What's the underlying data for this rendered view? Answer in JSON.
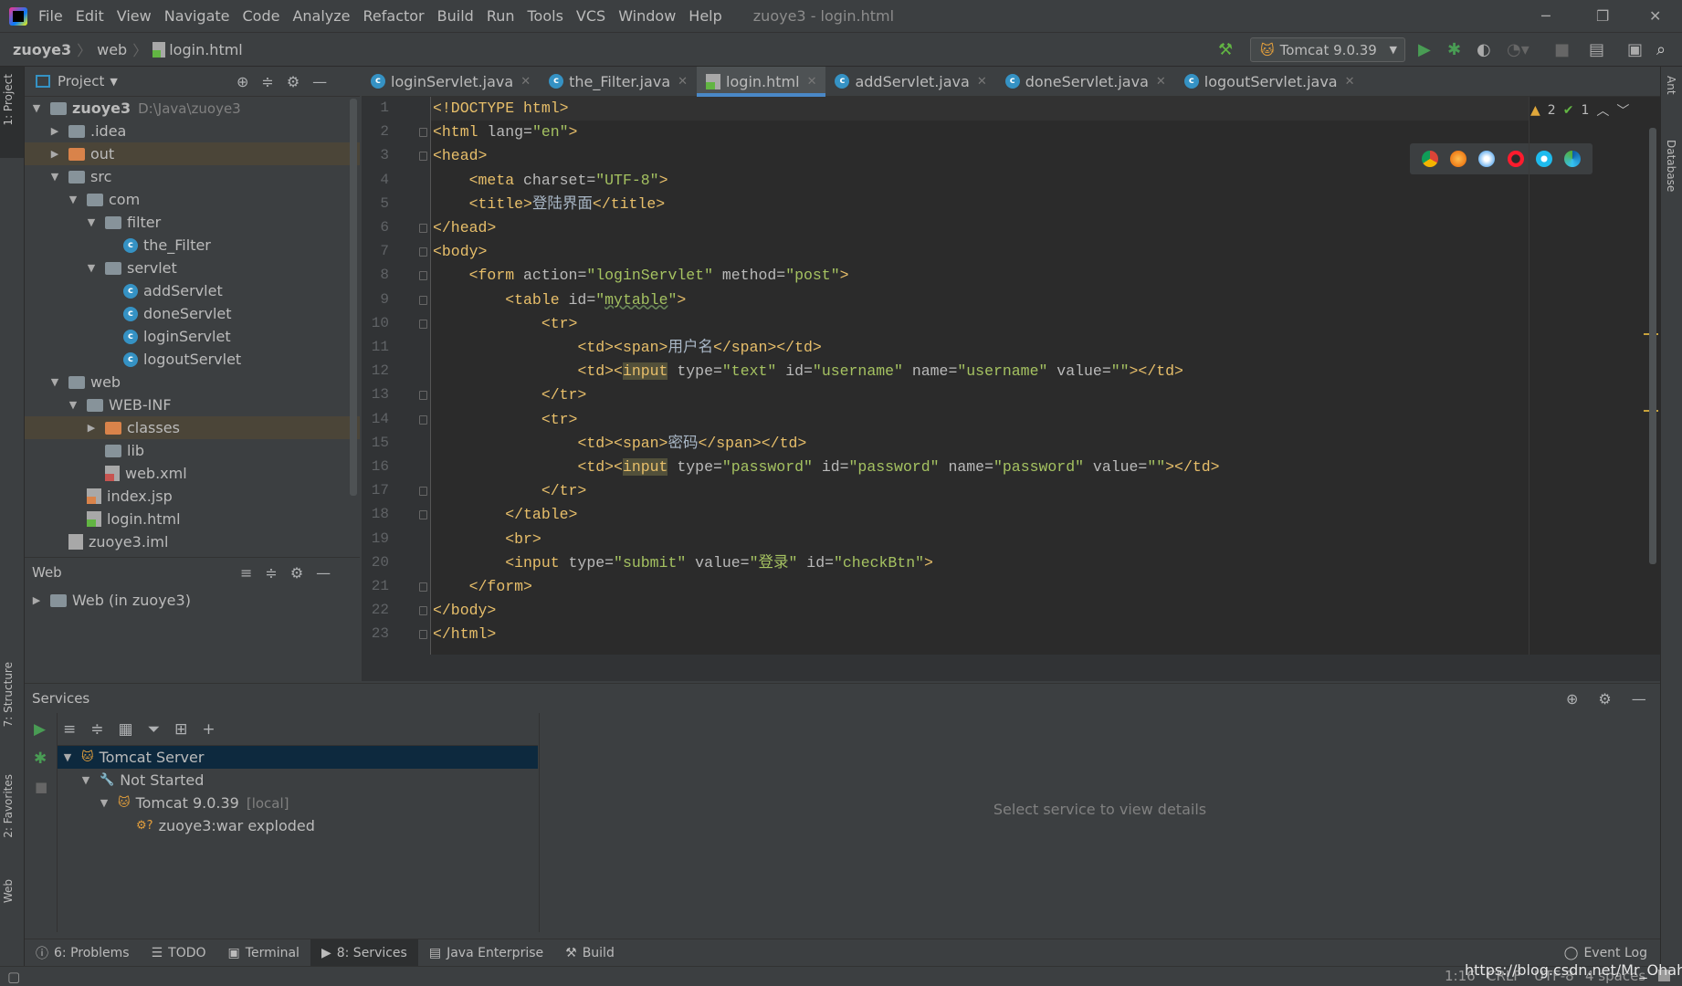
{
  "window": {
    "title": "zuoye3 - login.html",
    "menu": [
      "File",
      "Edit",
      "View",
      "Navigate",
      "Code",
      "Analyze",
      "Refactor",
      "Build",
      "Run",
      "Tools",
      "VCS",
      "Window",
      "Help"
    ]
  },
  "breadcrumb": [
    "zuoye3",
    "web",
    "login.html"
  ],
  "run_config": "Tomcat 9.0.39",
  "left_strip": [
    "1: Project",
    "7: Structure",
    "2: Favorites",
    "Web"
  ],
  "right_strip": [
    "Ant",
    "Database"
  ],
  "project": {
    "title": "Project",
    "tree": [
      {
        "label": "zuoye3",
        "extra": "D:\\Java\\zuoye3",
        "depth": 0,
        "arrow": "down",
        "icon": "module",
        "bold": true
      },
      {
        "label": ".idea",
        "depth": 1,
        "arrow": "right",
        "icon": "folder"
      },
      {
        "label": "out",
        "depth": 1,
        "arrow": "right",
        "icon": "folder-orange",
        "selected": true
      },
      {
        "label": "src",
        "depth": 1,
        "arrow": "down",
        "icon": "folder-blue"
      },
      {
        "label": "com",
        "depth": 2,
        "arrow": "down",
        "icon": "package"
      },
      {
        "label": "filter",
        "depth": 3,
        "arrow": "down",
        "icon": "package"
      },
      {
        "label": "the_Filter",
        "depth": 4,
        "icon": "class"
      },
      {
        "label": "servlet",
        "depth": 3,
        "arrow": "down",
        "icon": "package"
      },
      {
        "label": "addServlet",
        "depth": 4,
        "icon": "class"
      },
      {
        "label": "doneServlet",
        "depth": 4,
        "icon": "class"
      },
      {
        "label": "loginServlet",
        "depth": 4,
        "icon": "class"
      },
      {
        "label": "logoutServlet",
        "depth": 4,
        "icon": "class"
      },
      {
        "label": "web",
        "depth": 1,
        "arrow": "down",
        "icon": "folder-web"
      },
      {
        "label": "WEB-INF",
        "depth": 2,
        "arrow": "down",
        "icon": "folder"
      },
      {
        "label": "classes",
        "depth": 3,
        "arrow": "right",
        "icon": "folder-orange",
        "selected": true
      },
      {
        "label": "lib",
        "depth": 3,
        "icon": "folder"
      },
      {
        "label": "web.xml",
        "depth": 3,
        "icon": "xml"
      },
      {
        "label": "index.jsp",
        "depth": 2,
        "icon": "jsp"
      },
      {
        "label": "login.html",
        "depth": 2,
        "icon": "html"
      },
      {
        "label": "zuoye3.iml",
        "depth": 1,
        "icon": "iml"
      }
    ]
  },
  "web_panel": {
    "title": "Web",
    "items": [
      "Web (in zuoye3)"
    ]
  },
  "tabs": [
    {
      "label": "loginServlet.java",
      "icon": "class"
    },
    {
      "label": "the_Filter.java",
      "icon": "class"
    },
    {
      "label": "login.html",
      "icon": "html",
      "active": true
    },
    {
      "label": "addServlet.java",
      "icon": "class"
    },
    {
      "label": "doneServlet.java",
      "icon": "class"
    },
    {
      "label": "logoutServlet.java",
      "icon": "class"
    }
  ],
  "inspections": {
    "warnings": "2",
    "ok": "1"
  },
  "browsers": [
    "chrome",
    "firefox",
    "safari",
    "opera",
    "ie",
    "edge"
  ],
  "code": [
    [
      [
        "t-tag",
        "<!DOCTYPE html>"
      ]
    ],
    [
      [
        "t-tag",
        "<html "
      ],
      [
        "t-attr",
        "lang="
      ],
      [
        "t-val",
        "\"en\""
      ],
      [
        "t-tag",
        ">"
      ]
    ],
    [
      [
        "t-tag",
        "<head>"
      ]
    ],
    [
      [
        "t-text",
        "    "
      ],
      [
        "t-tag",
        "<meta "
      ],
      [
        "t-attr",
        "charset="
      ],
      [
        "t-val",
        "\"UTF-8\""
      ],
      [
        "t-tag",
        ">"
      ]
    ],
    [
      [
        "t-text",
        "    "
      ],
      [
        "t-tag",
        "<title>"
      ],
      [
        "t-text",
        "登陆界面"
      ],
      [
        "t-tag",
        "</title>"
      ]
    ],
    [
      [
        "t-tag",
        "</head>"
      ]
    ],
    [
      [
        "t-tag",
        "<body>"
      ]
    ],
    [
      [
        "t-text",
        "    "
      ],
      [
        "t-tag",
        "<form "
      ],
      [
        "t-attr",
        "action="
      ],
      [
        "t-val",
        "\"loginServlet\""
      ],
      [
        "t-attr",
        " method="
      ],
      [
        "t-val",
        "\"post\""
      ],
      [
        "t-tag",
        ">"
      ]
    ],
    [
      [
        "t-text",
        "        "
      ],
      [
        "t-tag",
        "<table "
      ],
      [
        "t-attr",
        "id="
      ],
      [
        "t-val",
        "\""
      ],
      [
        "t-und",
        "mytable"
      ],
      [
        "t-val",
        "\""
      ],
      [
        "t-tag",
        ">"
      ]
    ],
    [
      [
        "t-text",
        "            "
      ],
      [
        "t-tag",
        "<tr>"
      ]
    ],
    [
      [
        "t-text",
        "                "
      ],
      [
        "t-tag",
        "<td><span>"
      ],
      [
        "t-text",
        "用户名"
      ],
      [
        "t-tag",
        "</span></td>"
      ]
    ],
    [
      [
        "t-text",
        "                "
      ],
      [
        "t-tag",
        "<td><"
      ],
      [
        "t-hl",
        "input"
      ],
      [
        "t-attr",
        " type="
      ],
      [
        "t-val",
        "\"text\""
      ],
      [
        "t-attr",
        " id="
      ],
      [
        "t-val",
        "\"username\""
      ],
      [
        "t-attr",
        " name="
      ],
      [
        "t-val",
        "\"username\""
      ],
      [
        "t-attr",
        " value="
      ],
      [
        "t-val",
        "\"\""
      ],
      [
        "t-tag",
        "></td>"
      ]
    ],
    [
      [
        "t-text",
        "            "
      ],
      [
        "t-tag",
        "</tr>"
      ]
    ],
    [
      [
        "t-text",
        "            "
      ],
      [
        "t-tag",
        "<tr>"
      ]
    ],
    [
      [
        "t-text",
        "                "
      ],
      [
        "t-tag",
        "<td><span>"
      ],
      [
        "t-text",
        "密码"
      ],
      [
        "t-tag",
        "</span></td>"
      ]
    ],
    [
      [
        "t-text",
        "                "
      ],
      [
        "t-tag",
        "<td><"
      ],
      [
        "t-hl",
        "input"
      ],
      [
        "t-attr",
        " type="
      ],
      [
        "t-val",
        "\"password\""
      ],
      [
        "t-attr",
        " id="
      ],
      [
        "t-val",
        "\"password\""
      ],
      [
        "t-attr",
        " name="
      ],
      [
        "t-val",
        "\"password\""
      ],
      [
        "t-attr",
        " value="
      ],
      [
        "t-val",
        "\"\""
      ],
      [
        "t-tag",
        "></td>"
      ]
    ],
    [
      [
        "t-text",
        "            "
      ],
      [
        "t-tag",
        "</tr>"
      ]
    ],
    [
      [
        "t-text",
        "        "
      ],
      [
        "t-tag",
        "</table>"
      ]
    ],
    [
      [
        "t-text",
        "        "
      ],
      [
        "t-tag",
        "<br>"
      ]
    ],
    [
      [
        "t-text",
        "        "
      ],
      [
        "t-tag",
        "<input "
      ],
      [
        "t-attr",
        "type="
      ],
      [
        "t-val",
        "\"submit\""
      ],
      [
        "t-attr",
        " value="
      ],
      [
        "t-val",
        "\"登录\""
      ],
      [
        "t-attr",
        " id="
      ],
      [
        "t-val",
        "\"checkBtn\""
      ],
      [
        "t-tag",
        ">"
      ]
    ],
    [
      [
        "t-text",
        "    "
      ],
      [
        "t-tag",
        "</form>"
      ]
    ],
    [
      [
        "t-tag",
        "</body>"
      ]
    ],
    [
      [
        "t-tag",
        "</html>"
      ]
    ]
  ],
  "services": {
    "title": "Services",
    "tree": [
      {
        "label": "Tomcat Server",
        "depth": 0,
        "selected": true
      },
      {
        "label": "Not Started",
        "depth": 1
      },
      {
        "label": "Tomcat 9.0.39",
        "extra": "[local]",
        "depth": 2
      },
      {
        "label": "zuoye3:war exploded",
        "depth": 3
      }
    ],
    "detail": "Select service to view details"
  },
  "bottom_tabs": [
    {
      "label": "6: Problems"
    },
    {
      "label": "TODO"
    },
    {
      "label": "Terminal"
    },
    {
      "label": "8: Services",
      "active": true
    },
    {
      "label": "Java Enterprise"
    },
    {
      "label": "Build"
    }
  ],
  "event_log": "Event Log",
  "status": {
    "position": "1:16",
    "line_sep": "CRLF",
    "encoding": "UTF-8",
    "indent": "4 spaces"
  },
  "watermark": "https://blog.csdn.net/Mr_Ohahah"
}
